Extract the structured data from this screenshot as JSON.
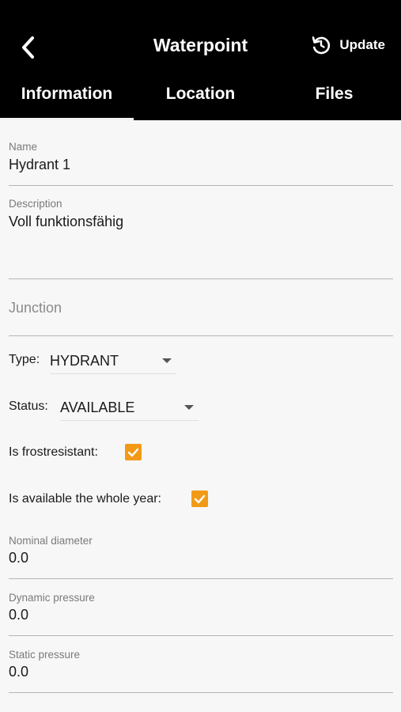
{
  "header": {
    "title": "Waterpoint",
    "back_icon": "chevron-left-icon",
    "update_icon": "refresh-icon",
    "update_label": "Update"
  },
  "tabs": [
    {
      "label": "Information",
      "active": true
    },
    {
      "label": "Location",
      "active": false
    },
    {
      "label": "Files",
      "active": false
    }
  ],
  "form": {
    "name": {
      "label": "Name",
      "value": "Hydrant 1"
    },
    "description": {
      "label": "Description",
      "value": "Voll funktionsfähig"
    },
    "junction": {
      "placeholder": "Junction"
    },
    "type": {
      "label": "Type:",
      "value": "HYDRANT"
    },
    "status": {
      "label": "Status:",
      "value": "AVAILABLE"
    },
    "frostresistant": {
      "label": "Is frostresistant:",
      "checked": true
    },
    "available_year": {
      "label": "Is available the whole year:",
      "checked": true
    },
    "nominal_diameter": {
      "label": "Nominal diameter",
      "value": "0.0"
    },
    "dynamic_pressure": {
      "label": "Dynamic pressure",
      "value": "0.0"
    },
    "static_pressure": {
      "label": "Static pressure",
      "value": "0.0"
    }
  },
  "colors": {
    "header_bg": "#000000",
    "checkbox_accent": "#f29a17",
    "page_bg": "#f7f7f7"
  }
}
